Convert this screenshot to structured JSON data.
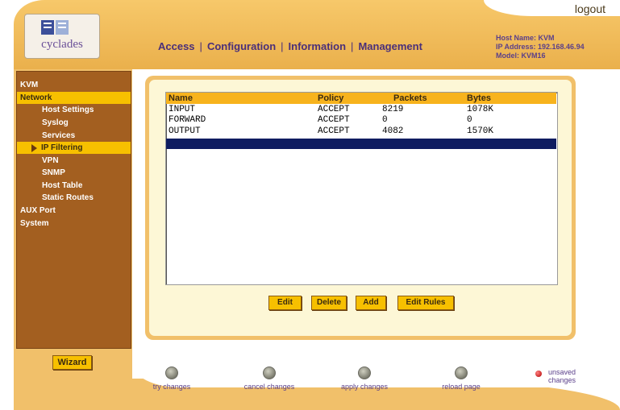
{
  "header": {
    "logout_label": "logout",
    "logo_text": "cyclades",
    "nav": [
      "Access",
      "Configuration",
      "Information",
      "Management"
    ],
    "nav_sep": "|",
    "host_name": "Host Name: KVM",
    "ip_address": "IP Address: 192.168.46.94",
    "model": "Model: KVM16"
  },
  "sidebar": {
    "items": [
      {
        "label": "KVM"
      },
      {
        "label": "Network"
      },
      {
        "label": "Host Settings"
      },
      {
        "label": "Syslog"
      },
      {
        "label": "Services"
      },
      {
        "label": "IP Filtering"
      },
      {
        "label": "VPN"
      },
      {
        "label": "SNMP"
      },
      {
        "label": "Host Table"
      },
      {
        "label": "Static Routes"
      },
      {
        "label": "AUX Port"
      },
      {
        "label": "System"
      }
    ]
  },
  "table": {
    "columns": [
      "Name",
      "Policy",
      "Packets",
      "Bytes"
    ],
    "rows": [
      [
        "INPUT",
        "ACCEPT",
        "8219",
        "1078K"
      ],
      [
        "FORWARD",
        "ACCEPT",
        "0",
        "0"
      ],
      [
        "OUTPUT",
        "ACCEPT",
        "4082",
        "1570K"
      ]
    ]
  },
  "buttons": {
    "edit": "Edit",
    "delete": "Delete",
    "add": "Add",
    "edit_rules": "Edit Rules"
  },
  "footer": {
    "wizard": "Wizard",
    "try_changes": "try changes",
    "cancel_changes": "cancel changes",
    "apply_changes": "apply changes",
    "reload_page": "reload page",
    "unsaved_line1": "unsaved",
    "unsaved_line2": "changes"
  },
  "colors": {
    "accent": "#f7c000",
    "sidebar": "#a35f20",
    "selected_row": "#0f1c60",
    "nav_text": "#4a2f7a"
  }
}
